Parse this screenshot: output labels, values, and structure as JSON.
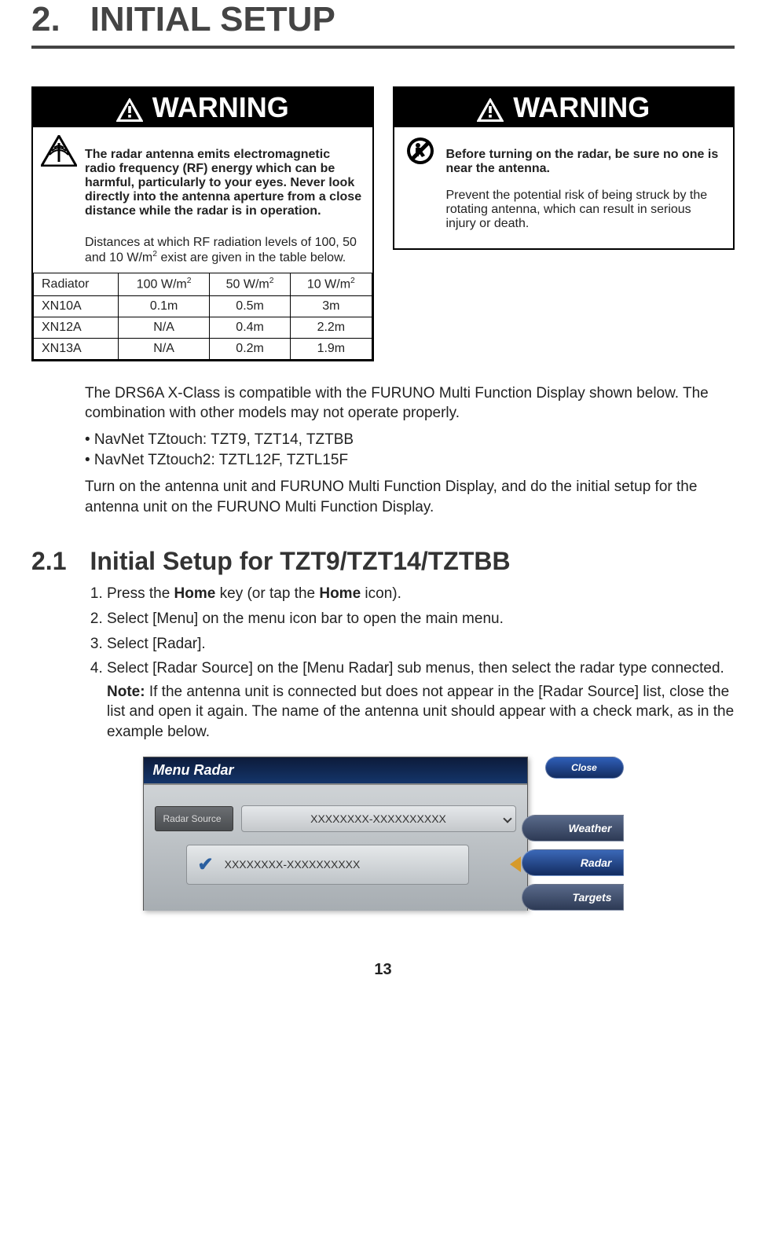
{
  "chapter": {
    "num": "2.",
    "title": "INITIAL SETUP"
  },
  "warning_label": "WARNING",
  "warning1": {
    "bold": "The radar antenna emits electromagnetic radio frequency (RF) energy which can be harmful, particularly to your eyes. Never look directly into the antenna aperture from a close distance while the radar is in operation.",
    "sub_a": "Distances at which RF radiation levels of 100, 50 and 10 W/m",
    "sub_b": " exist are given in the table below.",
    "sup": "2",
    "table": {
      "headers": [
        "Radiator",
        "100 W/m²",
        "50 W/m²",
        "10 W/m²"
      ],
      "rows": [
        [
          "XN10A",
          "0.1m",
          "0.5m",
          "3m"
        ],
        [
          "XN12A",
          "N/A",
          "0.4m",
          "2.2m"
        ],
        [
          "XN13A",
          "N/A",
          "0.2m",
          "1.9m"
        ]
      ]
    }
  },
  "warning2": {
    "bold": "Before turning on the radar, be sure no one is near the antenna.",
    "body": "Prevent the potential risk of being struck by the rotating antenna, which can result in serious injury or death."
  },
  "compat_intro": "The DRS6A X-Class is compatible with the FURUNO Multi Function Display shown below. The combination with other models may not operate properly.",
  "compat_items": [
    "NavNet TZtouch: TZT9, TZT14, TZTBB",
    "NavNet TZtouch2: TZTL12F, TZTL15F"
  ],
  "compat_outro": "Turn on the antenna unit and FURUNO Multi Function Display, and do the initial setup for the antenna unit on the FURUNO Multi Function Display.",
  "subchap": {
    "num": "2.1",
    "title": "Initial Setup for TZT9/TZT14/TZTBB"
  },
  "steps": {
    "s1a": "Press the ",
    "s1b": "Home",
    "s1c": " key (or tap the ",
    "s1d": "Home",
    "s1e": " icon).",
    "s2": "Select [Menu] on the menu icon bar to open the main menu.",
    "s3": "Select [Radar].",
    "s4": "Select [Radar Source] on the [Menu Radar] sub menus, then select the radar type connected.",
    "note_label": "Note:",
    "note": " If the antenna unit is connected but does not appear in the [Radar Source] list, close the list and open it again. The name of the antenna unit should appear with a check mark, as in the example below."
  },
  "menu_fig": {
    "title": "Menu Radar",
    "row_label": "Radar Source",
    "row_value": "XXXXXXXX-XXXXXXXXXX",
    "popup_value": "XXXXXXXX-XXXXXXXXXX",
    "btn_close": "Close",
    "tab_weather": "Weather",
    "tab_radar": "Radar",
    "tab_targets": "Targets"
  },
  "page_num": "13",
  "chart_data": {
    "type": "table",
    "title": "RF radiation distance",
    "columns": [
      "Radiator",
      "100 W/m²",
      "50 W/m²",
      "10 W/m²"
    ],
    "rows": [
      {
        "Radiator": "XN10A",
        "100 W/m²": "0.1m",
        "50 W/m²": "0.5m",
        "10 W/m²": "3m"
      },
      {
        "Radiator": "XN12A",
        "100 W/m²": "N/A",
        "50 W/m²": "0.4m",
        "10 W/m²": "2.2m"
      },
      {
        "Radiator": "XN13A",
        "100 W/m²": "N/A",
        "50 W/m²": "0.2m",
        "10 W/m²": "1.9m"
      }
    ]
  }
}
